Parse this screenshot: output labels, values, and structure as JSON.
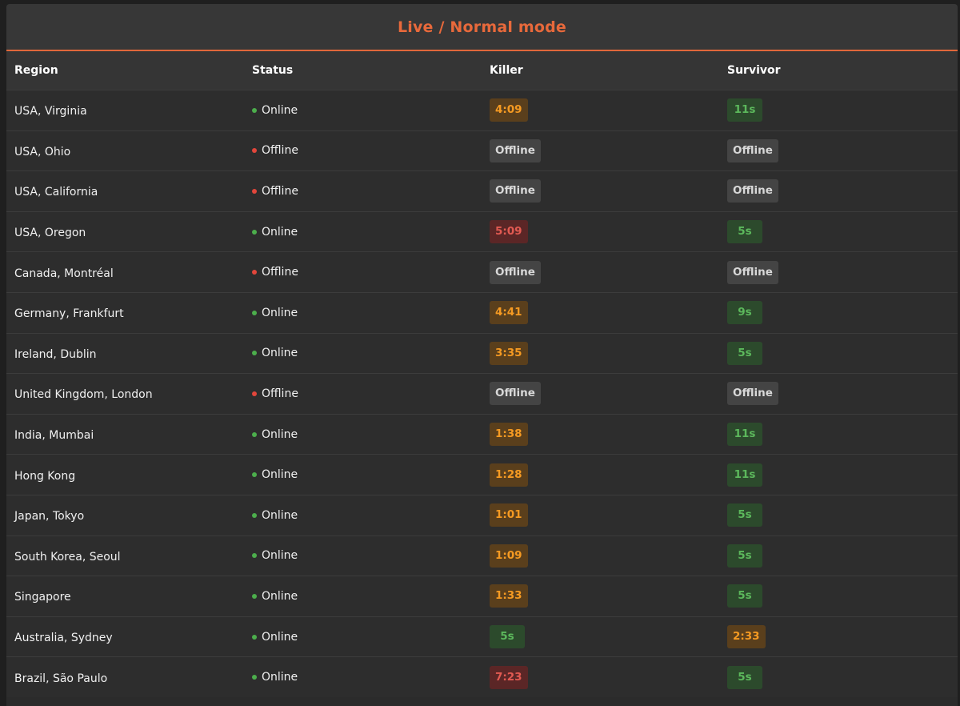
{
  "title": "Live / Normal mode",
  "columns": {
    "region": "Region",
    "status": "Status",
    "killer": "Killer",
    "survivor": "Survivor"
  },
  "colors": {
    "accent": "#e8693b",
    "online": "#4cae4c",
    "offline": "#e2463b",
    "queue_orange": "#f59a22",
    "queue_green": "#5cb85c",
    "queue_red": "#e25a52"
  },
  "rows": [
    {
      "region": "USA, Virginia",
      "status": "Online",
      "killer": "4:09",
      "killer_tone": "orange",
      "survivor": "11s",
      "survivor_tone": "green"
    },
    {
      "region": "USA, Ohio",
      "status": "Offline",
      "killer": "Offline",
      "killer_tone": "gray",
      "survivor": "Offline",
      "survivor_tone": "gray"
    },
    {
      "region": "USA, California",
      "status": "Offline",
      "killer": "Offline",
      "killer_tone": "gray",
      "survivor": "Offline",
      "survivor_tone": "gray"
    },
    {
      "region": "USA, Oregon",
      "status": "Online",
      "killer": "5:09",
      "killer_tone": "red",
      "survivor": "5s",
      "survivor_tone": "green"
    },
    {
      "region": "Canada, Montréal",
      "status": "Offline",
      "killer": "Offline",
      "killer_tone": "gray",
      "survivor": "Offline",
      "survivor_tone": "gray"
    },
    {
      "region": "Germany, Frankfurt",
      "status": "Online",
      "killer": "4:41",
      "killer_tone": "orange",
      "survivor": "9s",
      "survivor_tone": "green"
    },
    {
      "region": "Ireland, Dublin",
      "status": "Online",
      "killer": "3:35",
      "killer_tone": "orange",
      "survivor": "5s",
      "survivor_tone": "green"
    },
    {
      "region": "United Kingdom, London",
      "status": "Offline",
      "killer": "Offline",
      "killer_tone": "gray",
      "survivor": "Offline",
      "survivor_tone": "gray"
    },
    {
      "region": "India, Mumbai",
      "status": "Online",
      "killer": "1:38",
      "killer_tone": "orange",
      "survivor": "11s",
      "survivor_tone": "green"
    },
    {
      "region": "Hong Kong",
      "status": "Online",
      "killer": "1:28",
      "killer_tone": "orange",
      "survivor": "11s",
      "survivor_tone": "green"
    },
    {
      "region": "Japan, Tokyo",
      "status": "Online",
      "killer": "1:01",
      "killer_tone": "orange",
      "survivor": "5s",
      "survivor_tone": "green"
    },
    {
      "region": "South Korea, Seoul",
      "status": "Online",
      "killer": "1:09",
      "killer_tone": "orange",
      "survivor": "5s",
      "survivor_tone": "green"
    },
    {
      "region": "Singapore",
      "status": "Online",
      "killer": "1:33",
      "killer_tone": "orange",
      "survivor": "5s",
      "survivor_tone": "green"
    },
    {
      "region": "Australia, Sydney",
      "status": "Online",
      "killer": "5s",
      "killer_tone": "green",
      "survivor": "2:33",
      "survivor_tone": "orange"
    },
    {
      "region": "Brazil, São Paulo",
      "status": "Online",
      "killer": "7:23",
      "killer_tone": "red",
      "survivor": "5s",
      "survivor_tone": "green"
    }
  ]
}
